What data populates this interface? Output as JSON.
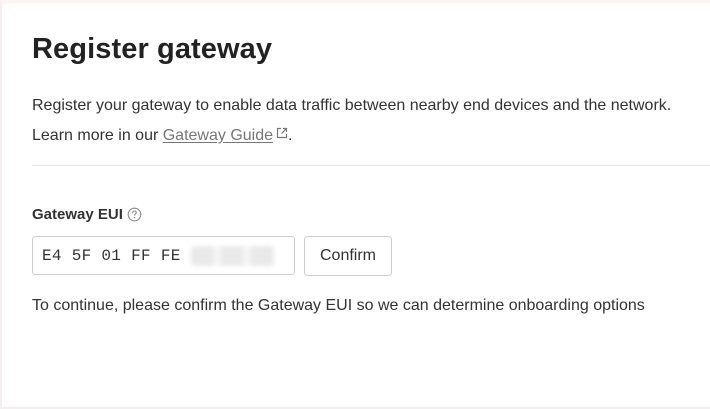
{
  "page": {
    "title": "Register gateway",
    "description_line1": "Register your gateway to enable data traffic between nearby end devices and the network.",
    "description_prefix": "Learn more in our ",
    "guide_link_label": "Gateway Guide",
    "description_suffix": "."
  },
  "form": {
    "eui_label": "Gateway EUI",
    "help_icon": "question-circle-icon",
    "eui_value_visible": "E4 5F 01 FF FE",
    "confirm_label": "Confirm",
    "hint": "To continue, please confirm the Gateway EUI so we can determine onboarding options"
  },
  "icons": {
    "external_link": "external-link-icon"
  },
  "colors": {
    "link": "#777777",
    "text": "#222222",
    "border": "#cfcfcf"
  }
}
